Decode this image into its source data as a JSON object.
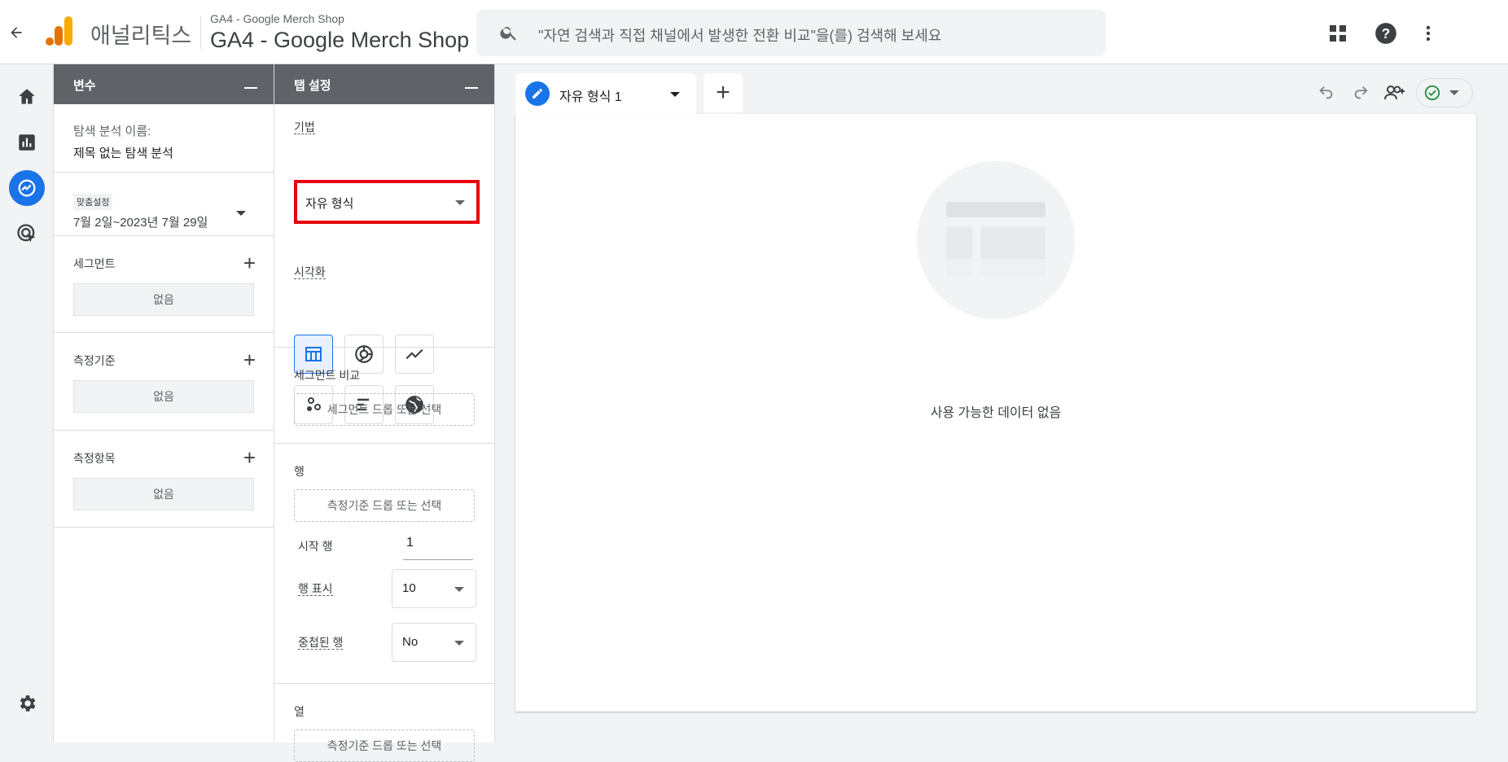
{
  "header": {
    "app_name": "애널리틱스",
    "property_small": "GA4 - Google Merch Shop",
    "property_big": "GA4 - Google Merch Shop",
    "search_placeholder": "\"자연 검색과 직접 채널에서 발생한 전환 비교\"을(를) 검색해 보세요"
  },
  "variables_panel": {
    "title": "변수",
    "exploration_name_label": "탐색 분석 이름:",
    "exploration_name_value": "제목 없는 탐색 분석",
    "date_badge": "맞춤설정",
    "date_range": "7월 2일~2023년 7월 29일",
    "segments_label": "세그먼트",
    "segments_value": "없음",
    "dimensions_label": "측정기준",
    "dimensions_value": "없음",
    "metrics_label": "측정항목",
    "metrics_value": "없음"
  },
  "tab_settings": {
    "title": "탭 설정",
    "technique_label": "기법",
    "technique_value": "자유 형식",
    "visualization_label": "시각화",
    "visualizations": [
      "table-icon",
      "donut-chart-icon",
      "line-chart-icon",
      "scatter-plot-icon",
      "bar-chart-icon",
      "globe-icon"
    ],
    "segment_compare_label": "세그먼트 비교",
    "segment_drop": "세그먼트 드롭 또는 선택",
    "rows_label": "행",
    "rows_drop": "측정기준 드롭 또는 선택",
    "start_row_label": "시작 행",
    "start_row_value": "1",
    "show_rows_label": "행 표시",
    "show_rows_value": "10",
    "nested_rows_label": "중첩된 행",
    "nested_rows_value": "No",
    "columns_label": "열",
    "columns_drop": "측정기준 드롭 또는 선택"
  },
  "canvas": {
    "tab_label": "자유 형식 1",
    "add_tab": "+",
    "empty_message": "사용 가능한 데이터 없음"
  },
  "colors": {
    "accent": "#1a73e8",
    "highlight_border": "#e8000b",
    "panel_header": "#5f6368",
    "logo_orange": "#f9ab00",
    "logo_dark": "#e37400",
    "success": "#1e8e3e"
  }
}
